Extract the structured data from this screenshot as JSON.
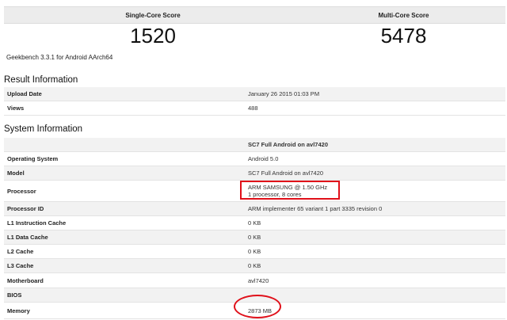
{
  "scores": {
    "single_label": "Single-Core Score",
    "multi_label": "Multi-Core Score",
    "single_value": "1520",
    "multi_value": "5478",
    "version": "Geekbench 3.3.1 for Android AArch64"
  },
  "result_info": {
    "title": "Result Information",
    "rows": [
      {
        "key": "Upload Date",
        "value": "January 26 2015 01:03 PM"
      },
      {
        "key": "Views",
        "value": "488"
      }
    ]
  },
  "system_info": {
    "title": "System Information",
    "header": "SC7 Full Android on avl7420",
    "rows": [
      {
        "key": "Operating System",
        "value": "Android 5.0"
      },
      {
        "key": "Model",
        "value": "SC7 Full Android on avl7420"
      },
      {
        "key": "Processor",
        "value": "ARM SAMSUNG @ 1.50 GHz",
        "value2": "1 processor, 8 cores"
      },
      {
        "key": "Processor ID",
        "value": "ARM implementer 65 variant 1 part 3335 revision 0"
      },
      {
        "key": "L1 Instruction Cache",
        "value": "0 KB"
      },
      {
        "key": "L1 Data Cache",
        "value": "0 KB"
      },
      {
        "key": "L2 Cache",
        "value": "0 KB"
      },
      {
        "key": "L3 Cache",
        "value": "0 KB"
      },
      {
        "key": "Motherboard",
        "value": "avl7420"
      },
      {
        "key": "BIOS",
        "value": ""
      },
      {
        "key": "Memory",
        "value": "2873 MB"
      }
    ]
  },
  "annotations": {
    "color": "#e0101a"
  }
}
